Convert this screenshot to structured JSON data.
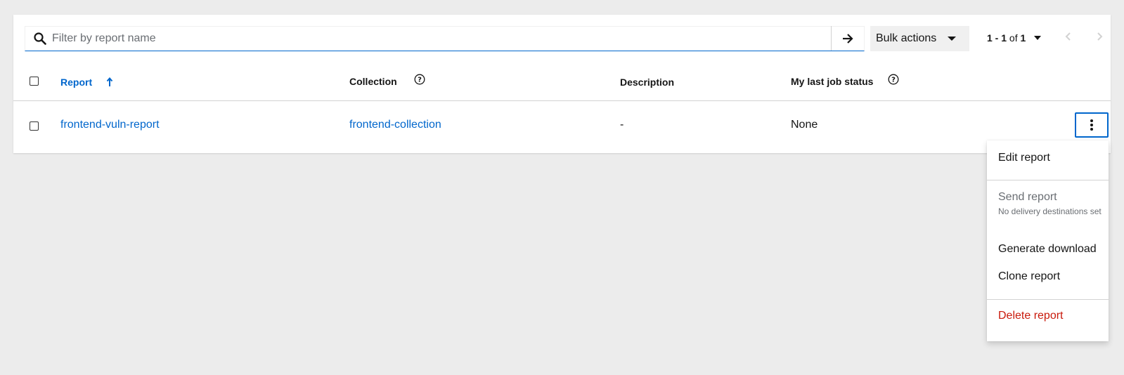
{
  "toolbar": {
    "search_placeholder": "Filter by report name",
    "search_value": "",
    "bulk_actions_label": "Bulk actions",
    "pagination": {
      "range": "1 - 1",
      "of_label": "of",
      "total": "1"
    }
  },
  "table": {
    "columns": [
      {
        "label": "Report",
        "sorted": "ascending",
        "has_help": false
      },
      {
        "label": "Collection",
        "has_help": true
      },
      {
        "label": "Description",
        "has_help": false
      },
      {
        "label": "My last job status",
        "has_help": true
      }
    ],
    "rows": [
      {
        "report": "frontend-vuln-report",
        "collection": "frontend-collection",
        "description": "-",
        "last_job_status": "None"
      }
    ]
  },
  "row_menu": {
    "items": [
      {
        "label": "Edit report"
      },
      {
        "label": "Send report",
        "description": "No delivery destinations set",
        "disabled": true
      },
      {
        "label": "Generate download"
      },
      {
        "label": "Clone report"
      },
      {
        "label": "Delete report",
        "danger": true
      }
    ]
  },
  "colors": {
    "link": "#0066cc",
    "danger": "#c9190b",
    "page_background": "#ececec",
    "muted_text": "#6a6e73"
  },
  "icons": {
    "search": "search-icon",
    "submit": "arrow-right-icon",
    "bulk_caret": "caret-down-icon",
    "sort": "sort-ascending-icon",
    "help": "question-circle-icon",
    "kebab": "kebab-icon",
    "prev": "angle-left-icon",
    "next": "angle-right-icon"
  }
}
